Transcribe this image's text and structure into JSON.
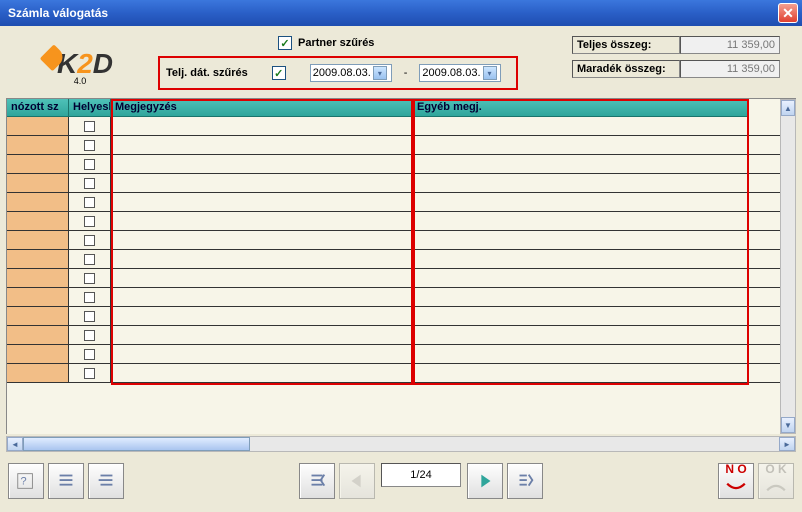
{
  "window": {
    "title": "Számla válogatás"
  },
  "logo": {
    "text_a": "K",
    "text_b": "2",
    "text_c": "D",
    "version": "4.0"
  },
  "filters": {
    "partner_filter_label": "Partner szűrés",
    "date_filter_label": "Telj. dát. szűrés",
    "date_from": "2009.08.03.",
    "date_to": "2009.08.03.",
    "partner_filter_checked": true,
    "date_filter_checked": true
  },
  "totals": {
    "total_label": "Teljes összeg:",
    "total_value": "11 359,00",
    "remaining_label": "Maradék összeg:",
    "remaining_value": "11 359,00"
  },
  "grid": {
    "columns": {
      "c1": "nózott sz",
      "c2": "Helyesl",
      "c3": "Megjegyzés",
      "c4": "Egyéb megj."
    },
    "row_count": 14
  },
  "pager": {
    "page_text": "1/24"
  },
  "buttons": {
    "no": "N O",
    "ok": "O K"
  }
}
